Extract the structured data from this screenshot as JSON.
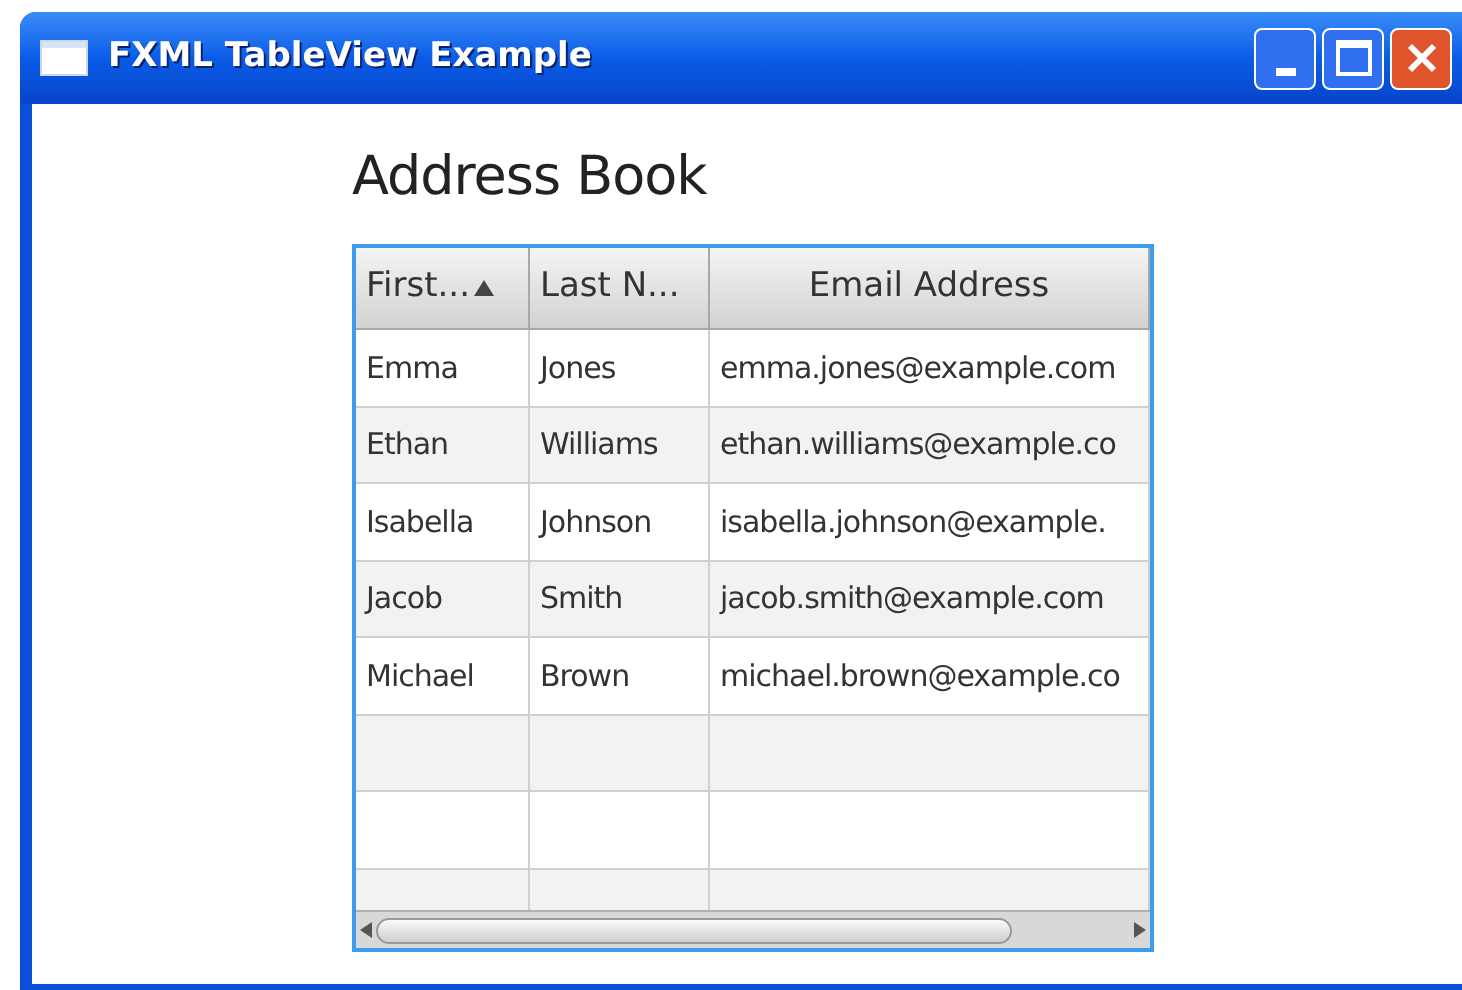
{
  "window": {
    "title": "FXML TableView Example"
  },
  "heading": "Address Book",
  "table": {
    "columns": [
      {
        "label": "First...",
        "sorted": true
      },
      {
        "label": "Last N...",
        "sorted": false
      },
      {
        "label": "Email Address",
        "sorted": false
      }
    ],
    "rows": [
      [
        "Emma",
        "Jones",
        "emma.jones@example.com"
      ],
      [
        "Ethan",
        "Williams",
        "ethan.williams@example.co"
      ],
      [
        "Isabella",
        "Johnson",
        "isabella.johnson@example."
      ],
      [
        "Jacob",
        "Smith",
        "jacob.smith@example.com"
      ],
      [
        "Michael",
        "Brown",
        "michael.brown@example.co"
      ]
    ]
  }
}
